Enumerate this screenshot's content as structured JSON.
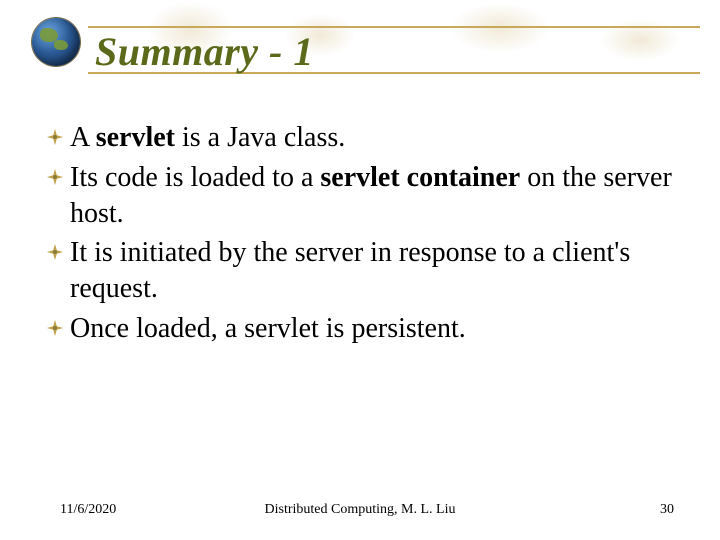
{
  "title": "Summary - 1",
  "bullets": [
    {
      "pre": "A ",
      "b1": "servlet",
      "mid": " is a Java class.",
      "b2": "",
      "post": ""
    },
    {
      "pre": "Its code is loaded to a ",
      "b1": "servlet container",
      "mid": " on the server host.",
      "b2": "",
      "post": ""
    },
    {
      "pre": "It is initiated by the server in response to a client's request.",
      "b1": "",
      "mid": "",
      "b2": "",
      "post": ""
    },
    {
      "pre": "Once loaded, a servlet is persistent.",
      "b1": "",
      "mid": "",
      "b2": "",
      "post": ""
    }
  ],
  "footer": {
    "date": "11/6/2020",
    "center": "Distributed Computing, M. L. Liu",
    "page": "30"
  },
  "colors": {
    "title": "#5a6a1a",
    "rule": "#c9a85a",
    "bullet": "#bfa24a"
  }
}
